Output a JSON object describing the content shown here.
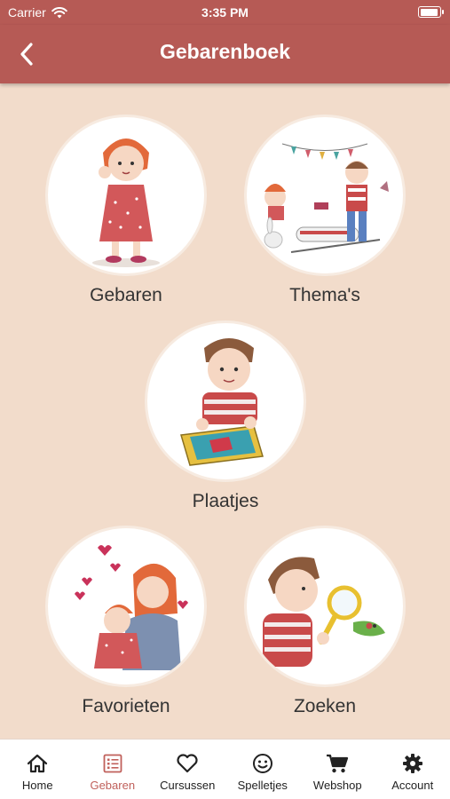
{
  "status": {
    "carrier": "Carrier",
    "time": "3:35 PM",
    "battery_level": 0.95
  },
  "nav": {
    "title": "Gebarenboek",
    "back_icon": "chevron-left-icon"
  },
  "tiles": [
    {
      "label": "Gebaren"
    },
    {
      "label": "Thema's"
    },
    {
      "label": "Plaatjes"
    },
    {
      "label": "Favorieten"
    },
    {
      "label": "Zoeken"
    }
  ],
  "tabs": [
    {
      "label": "Home",
      "icon": "home-icon"
    },
    {
      "label": "Gebaren",
      "icon": "list-icon",
      "active": true
    },
    {
      "label": "Cursussen",
      "icon": "heart-icon"
    },
    {
      "label": "Spelletjes",
      "icon": "smiley-icon"
    },
    {
      "label": "Webshop",
      "icon": "cart-icon"
    },
    {
      "label": "Account",
      "icon": "gear-icon"
    }
  ],
  "colors": {
    "header": "#b65a55",
    "background": "#f2dccb",
    "active_tab": "#c0605b"
  }
}
